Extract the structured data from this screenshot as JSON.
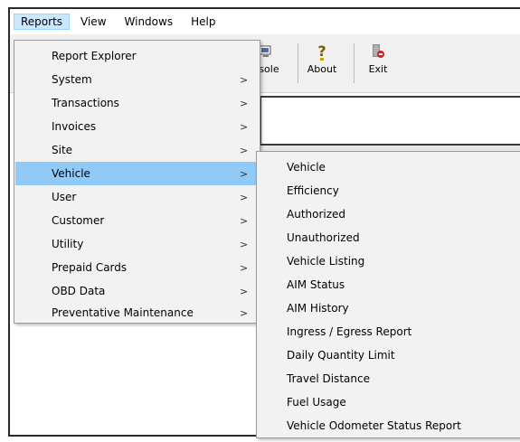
{
  "menubar": [
    "Reports",
    "View",
    "Windows",
    "Help"
  ],
  "toolbar": {
    "partial_label": "nsole",
    "about_label": "About",
    "exit_label": "Exit"
  },
  "reports_menu": [
    {
      "label": "Report Explorer",
      "submenu": false
    },
    {
      "label": "System",
      "submenu": true
    },
    {
      "label": "Transactions",
      "submenu": true
    },
    {
      "label": "Invoices",
      "submenu": true
    },
    {
      "label": "Site",
      "submenu": true
    },
    {
      "label": "Vehicle",
      "submenu": true,
      "selected": true
    },
    {
      "label": "User",
      "submenu": true
    },
    {
      "label": "Customer",
      "submenu": true
    },
    {
      "label": "Utility",
      "submenu": true
    },
    {
      "label": "Prepaid Cards",
      "submenu": true
    },
    {
      "label": "OBD Data",
      "submenu": true
    },
    {
      "label": "Preventative Maintenance",
      "submenu": true
    }
  ],
  "vehicle_submenu": [
    "Vehicle",
    "Efficiency",
    "Authorized",
    "Unauthorized",
    "Vehicle Listing",
    "AIM Status",
    "AIM History",
    "Ingress / Egress Report",
    "Daily Quantity Limit",
    "Travel Distance",
    "Fuel Usage",
    "Vehicle Odometer Status Report"
  ],
  "submenu_arrow": ">",
  "colors": {
    "selected_bg": "#91c9f7",
    "menu_bg": "#f2f2f2",
    "menubar_active": "#cce8ff"
  }
}
